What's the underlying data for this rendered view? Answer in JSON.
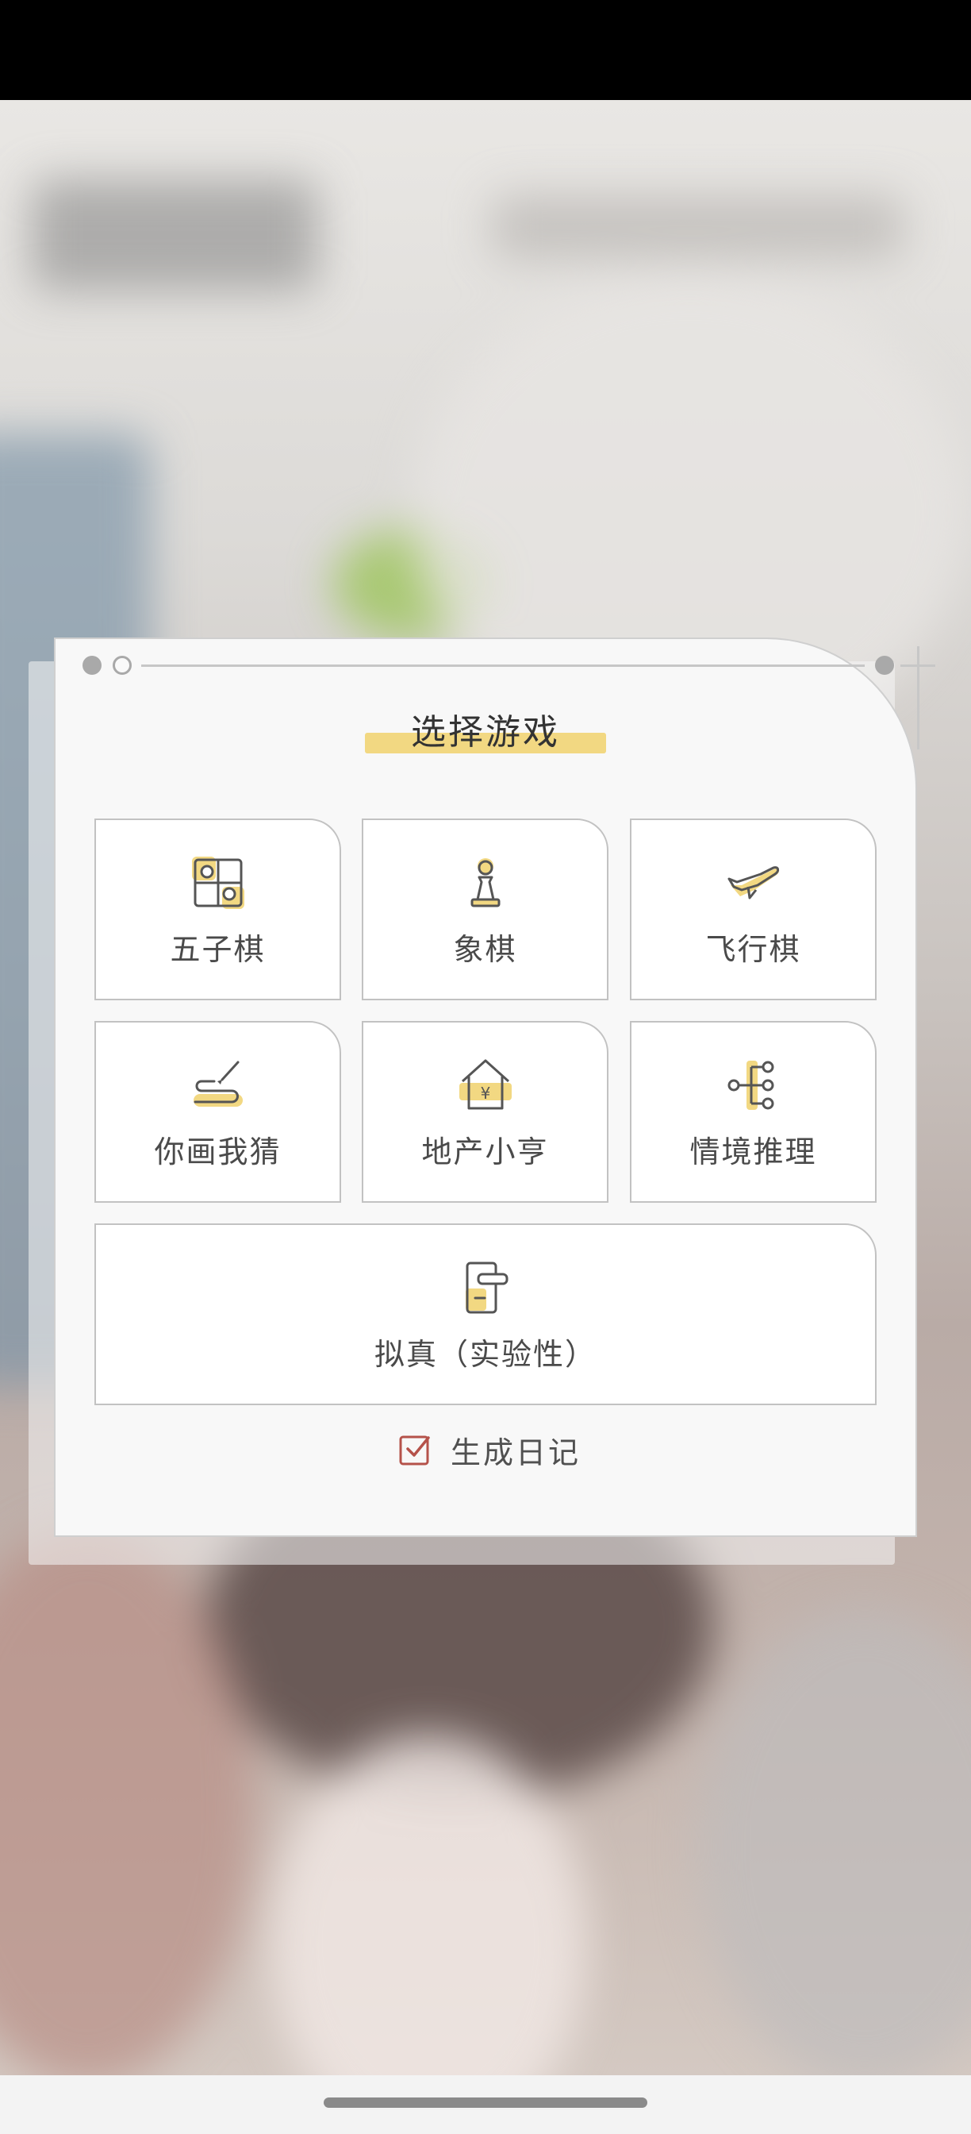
{
  "dialog": {
    "title": "选择游戏",
    "games": [
      {
        "label": "五子棋",
        "icon": "gomoku-board-icon"
      },
      {
        "label": "象棋",
        "icon": "chess-pawn-icon"
      },
      {
        "label": "飞行棋",
        "icon": "airplane-icon"
      },
      {
        "label": "你画我猜",
        "icon": "pencil-scribble-icon"
      },
      {
        "label": "地产小亨",
        "icon": "house-yuan-icon"
      },
      {
        "label": "情境推理",
        "icon": "mind-map-icon"
      },
      {
        "label": "拟真（实验性）",
        "icon": "door-phone-icon"
      }
    ],
    "diary": {
      "label": "生成日记",
      "checked": true,
      "icon": "checkbox-checked-icon"
    }
  },
  "colors": {
    "highlight": "#f2d882",
    "card_border": "#c2c2c2",
    "dialog_bg": "#f8f8f8",
    "checkbox_accent": "#b5524a",
    "status_bar": "#000000"
  }
}
